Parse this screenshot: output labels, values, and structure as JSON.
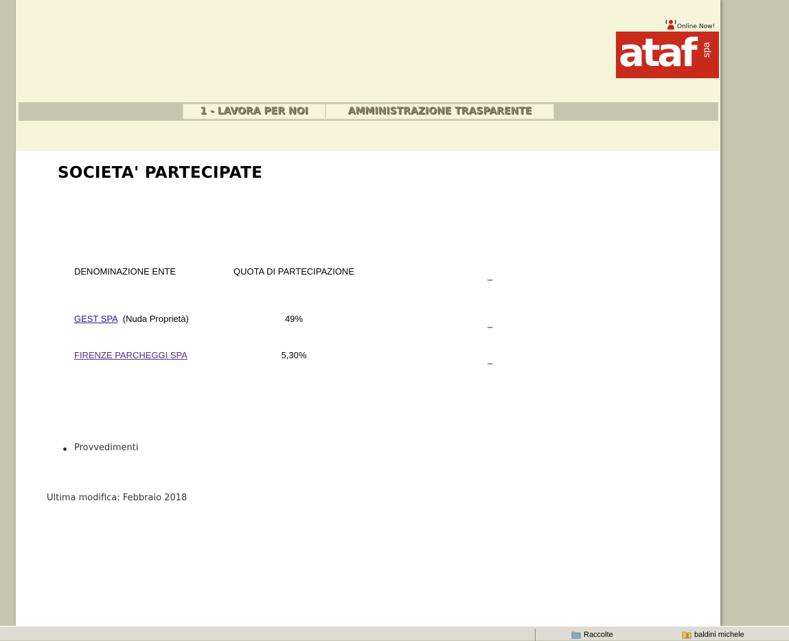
{
  "header": {
    "online_label": "Online Now!",
    "logo_main": "ataf",
    "logo_suffix": "spa",
    "logo_color": "#c82a1c"
  },
  "nav": {
    "items": [
      {
        "label": "1 - LAVORA PER NOI"
      },
      {
        "label": "AMMINISTRAZIONE TRASPARENTE"
      }
    ]
  },
  "page": {
    "title": "SOCIETA' PARTECIPATE"
  },
  "table": {
    "headers": [
      "DENOMINAZIONE ENTE",
      "QUOTA DI PARTECIPAZIONE",
      "_"
    ],
    "rows": [
      {
        "name": "GEST SPA",
        "note": "(Nuda Proprietà)",
        "quota": "49%",
        "extra": "_"
      },
      {
        "name": "FIRENZE PARCHEGGI SPA",
        "note": "",
        "quota": "5,30%",
        "extra": "_"
      }
    ]
  },
  "list": {
    "items": [
      "Provvedimenti"
    ]
  },
  "footer": {
    "last_modified": "Ultima modifica: Febbraio 2018"
  },
  "taskbar": {
    "items": [
      {
        "label": "Raccolte",
        "icon": "folder-icon"
      },
      {
        "label": "baldini michele",
        "icon": "user-folder-icon"
      }
    ]
  }
}
